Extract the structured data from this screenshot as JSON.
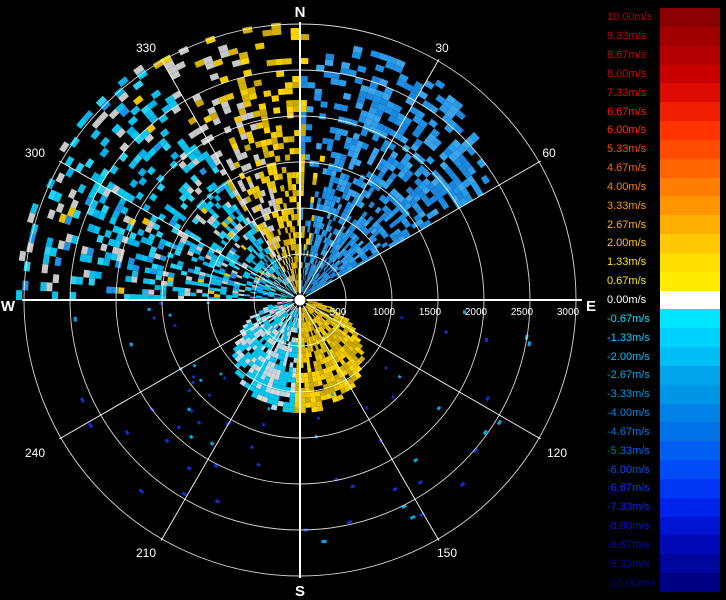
{
  "compass": {
    "north": "N",
    "east": "E",
    "south": "S",
    "west": "W"
  },
  "azimuth_labels": [
    "30",
    "60",
    "120",
    "150",
    "210",
    "240",
    "300",
    "330"
  ],
  "range_labels": [
    "500",
    "1000",
    "1500",
    "2000",
    "2500",
    "3000"
  ],
  "legend": {
    "items": [
      {
        "label": "10.00m/s",
        "color": "#8b0000",
        "text_color": "#b00000"
      },
      {
        "label": "9.33m/s",
        "color": "#a00000",
        "text_color": "#c00000"
      },
      {
        "label": "8.67m/s",
        "color": "#b40000",
        "text_color": "#d00000"
      },
      {
        "label": "8.00m/s",
        "color": "#c80000",
        "text_color": "#e00000"
      },
      {
        "label": "7.33m/s",
        "color": "#dc0a00",
        "text_color": "#f00000"
      },
      {
        "label": "6.67m/s",
        "color": "#f01e00",
        "text_color": "#ff1a00"
      },
      {
        "label": "6.00m/s",
        "color": "#ff3200",
        "text_color": "#ff3300"
      },
      {
        "label": "5.33m/s",
        "color": "#ff4b00",
        "text_color": "#ff4d00"
      },
      {
        "label": "4.67m/s",
        "color": "#ff6400",
        "text_color": "#ff6600"
      },
      {
        "label": "4.00m/s",
        "color": "#ff7d00",
        "text_color": "#ff8000"
      },
      {
        "label": "3.33m/s",
        "color": "#ff9600",
        "text_color": "#ff9900"
      },
      {
        "label": "2.67m/s",
        "color": "#ffaf00",
        "text_color": "#ffb300"
      },
      {
        "label": "2.00m/s",
        "color": "#ffc800",
        "text_color": "#ffcc00"
      },
      {
        "label": "1.33m/s",
        "color": "#ffdc00",
        "text_color": "#ffe000"
      },
      {
        "label": "0.67m/s",
        "color": "#ffeb00",
        "text_color": "#ffee00"
      },
      {
        "label": "0.00m/s",
        "color": "#ffffff",
        "text_color": "#ffffff"
      },
      {
        "label": "-0.67m/s",
        "color": "#00e6ff",
        "text_color": "#00e6ff"
      },
      {
        "label": "-1.33m/s",
        "color": "#00d2ff",
        "text_color": "#00d2ff"
      },
      {
        "label": "-2.00m/s",
        "color": "#00bef5",
        "text_color": "#00c0f5"
      },
      {
        "label": "-2.67m/s",
        "color": "#00a5eb",
        "text_color": "#00a8eb"
      },
      {
        "label": "-3.33m/s",
        "color": "#0096e6",
        "text_color": "#0098e6"
      },
      {
        "label": "-4.00m/s",
        "color": "#0082e6",
        "text_color": "#0088e6"
      },
      {
        "label": "-4.67m/s",
        "color": "#0073e6",
        "text_color": "#0078e6"
      },
      {
        "label": "-5.33m/s",
        "color": "#005ff0",
        "text_color": "#0066f0"
      },
      {
        "label": "-6.00m/s",
        "color": "#004bf5",
        "text_color": "#0050f5"
      },
      {
        "label": "-6.67m/s",
        "color": "#0037f5",
        "text_color": "#003cf5"
      },
      {
        "label": "-7.33m/s",
        "color": "#0023eb",
        "text_color": "#0028eb"
      },
      {
        "label": "-8.00m/s",
        "color": "#0014d2",
        "text_color": "#0018d2"
      },
      {
        "label": "-8.67m/s",
        "color": "#000ab4",
        "text_color": "#000cb4"
      },
      {
        "label": "-9.33m/s",
        "color": "#00059b",
        "text_color": "#000a9b"
      },
      {
        "label": "-10.00m/s",
        "color": "#000082",
        "text_color": "#000096"
      }
    ]
  }
}
